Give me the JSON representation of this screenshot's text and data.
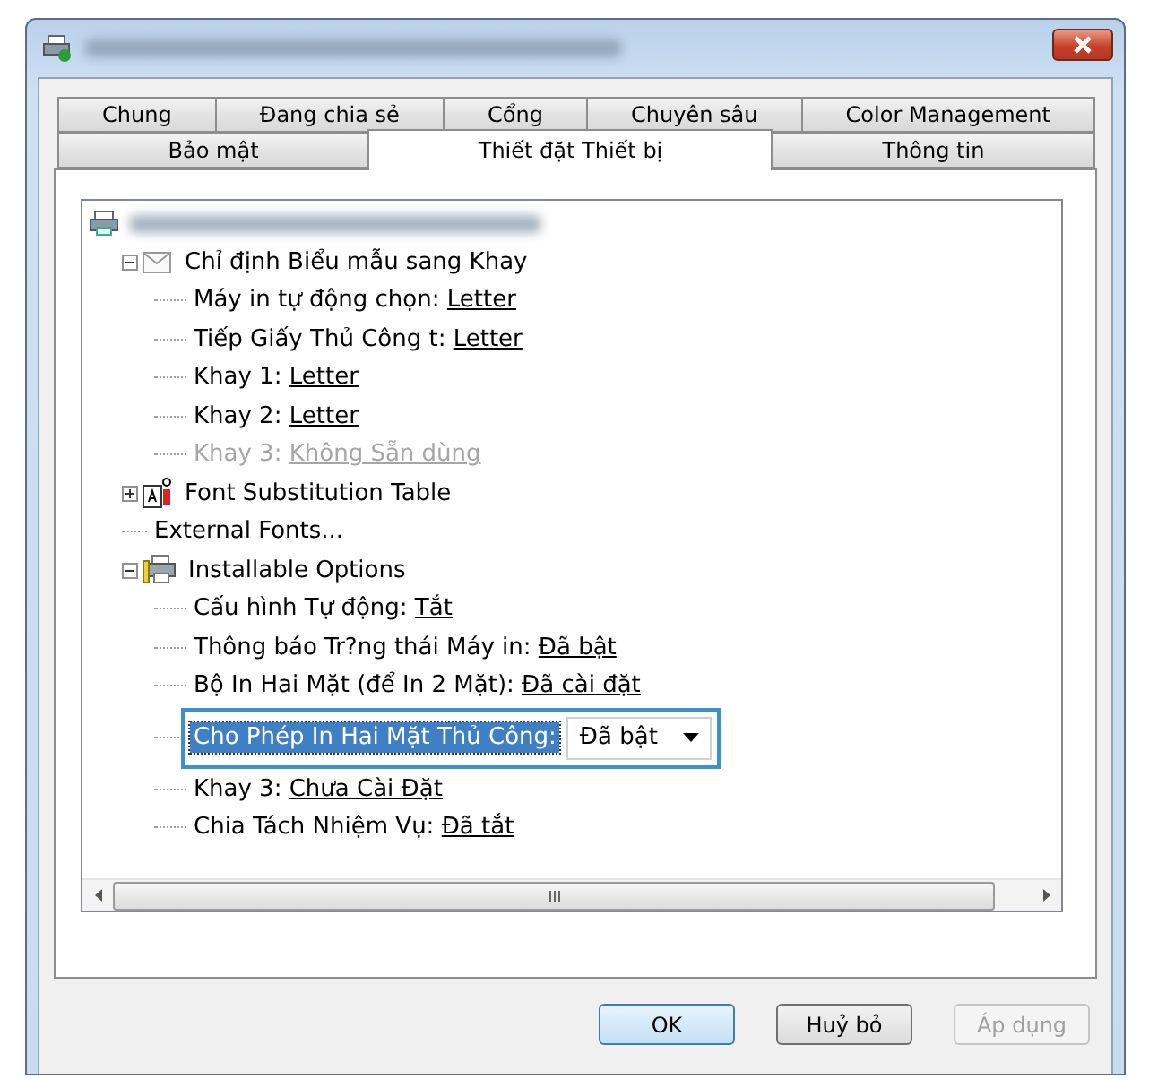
{
  "tab_rows": [
    [
      {
        "label": "Chung",
        "selected": false
      },
      {
        "label": "Đang chia sẻ",
        "selected": false
      },
      {
        "label": "Cổng",
        "selected": false
      },
      {
        "label": "Chuyên sâu",
        "selected": false
      },
      {
        "label": "Color Management",
        "selected": false
      }
    ],
    [
      {
        "label": "Bảo mật",
        "selected": false
      },
      {
        "label": "Thiết đặt Thiết bị",
        "selected": true
      },
      {
        "label": "Thông tin",
        "selected": false
      }
    ]
  ],
  "tree": [
    {
      "kind": "printer",
      "children": [
        {
          "kind": "forms",
          "label": "Chỉ định Biểu mẫu sang Khay",
          "expanded": true,
          "children": [
            {
              "kind": "setting",
              "label": "Máy in tự động chọn:",
              "value": "Letter",
              "disabled": false
            },
            {
              "kind": "setting",
              "label": "Tiếp Giấy Thủ Công t:",
              "value": "Letter",
              "disabled": false
            },
            {
              "kind": "setting",
              "label": "Khay 1:",
              "value": "Letter",
              "disabled": false
            },
            {
              "kind": "setting",
              "label": "Khay 2:",
              "value": "Letter",
              "disabled": false
            },
            {
              "kind": "setting",
              "label": "Khay 3:",
              "value": "Không Sẵn dùng",
              "disabled": true
            }
          ]
        },
        {
          "kind": "fonts",
          "label": "Font Substitution Table",
          "expanded": false
        },
        {
          "kind": "setting",
          "label": "External Fonts...",
          "disabled": false
        },
        {
          "kind": "options",
          "label": "Installable Options",
          "expanded": true,
          "children": [
            {
              "kind": "setting",
              "label": "Cấu hình Tự động:",
              "value": "Tắt",
              "disabled": false
            },
            {
              "kind": "setting",
              "label": "Thông báo Tr?ng thái Máy in:",
              "value": "Đã bật",
              "disabled": false
            },
            {
              "kind": "setting",
              "label": "Bộ In Hai Mặt (để In 2 Mặt):",
              "value": "Đã cài đặt",
              "disabled": false
            },
            {
              "kind": "dropdown",
              "label": "Cho Phép In Hai Mặt Thủ Công:",
              "value": "Đã bật",
              "selected": true
            },
            {
              "kind": "setting",
              "label": "Khay 3:",
              "value": "Chưa Cài Đặt",
              "disabled": false
            },
            {
              "kind": "setting",
              "label": "Chia Tách Nhiệm Vụ:",
              "value": "Đã tắt",
              "disabled": false
            }
          ]
        }
      ]
    }
  ],
  "buttons": [
    {
      "label": "OK",
      "kind": "default",
      "disabled": false
    },
    {
      "label": "Huỷ bỏ",
      "kind": "normal",
      "disabled": false
    },
    {
      "label": "Áp dụng",
      "kind": "normal",
      "disabled": true
    }
  ]
}
